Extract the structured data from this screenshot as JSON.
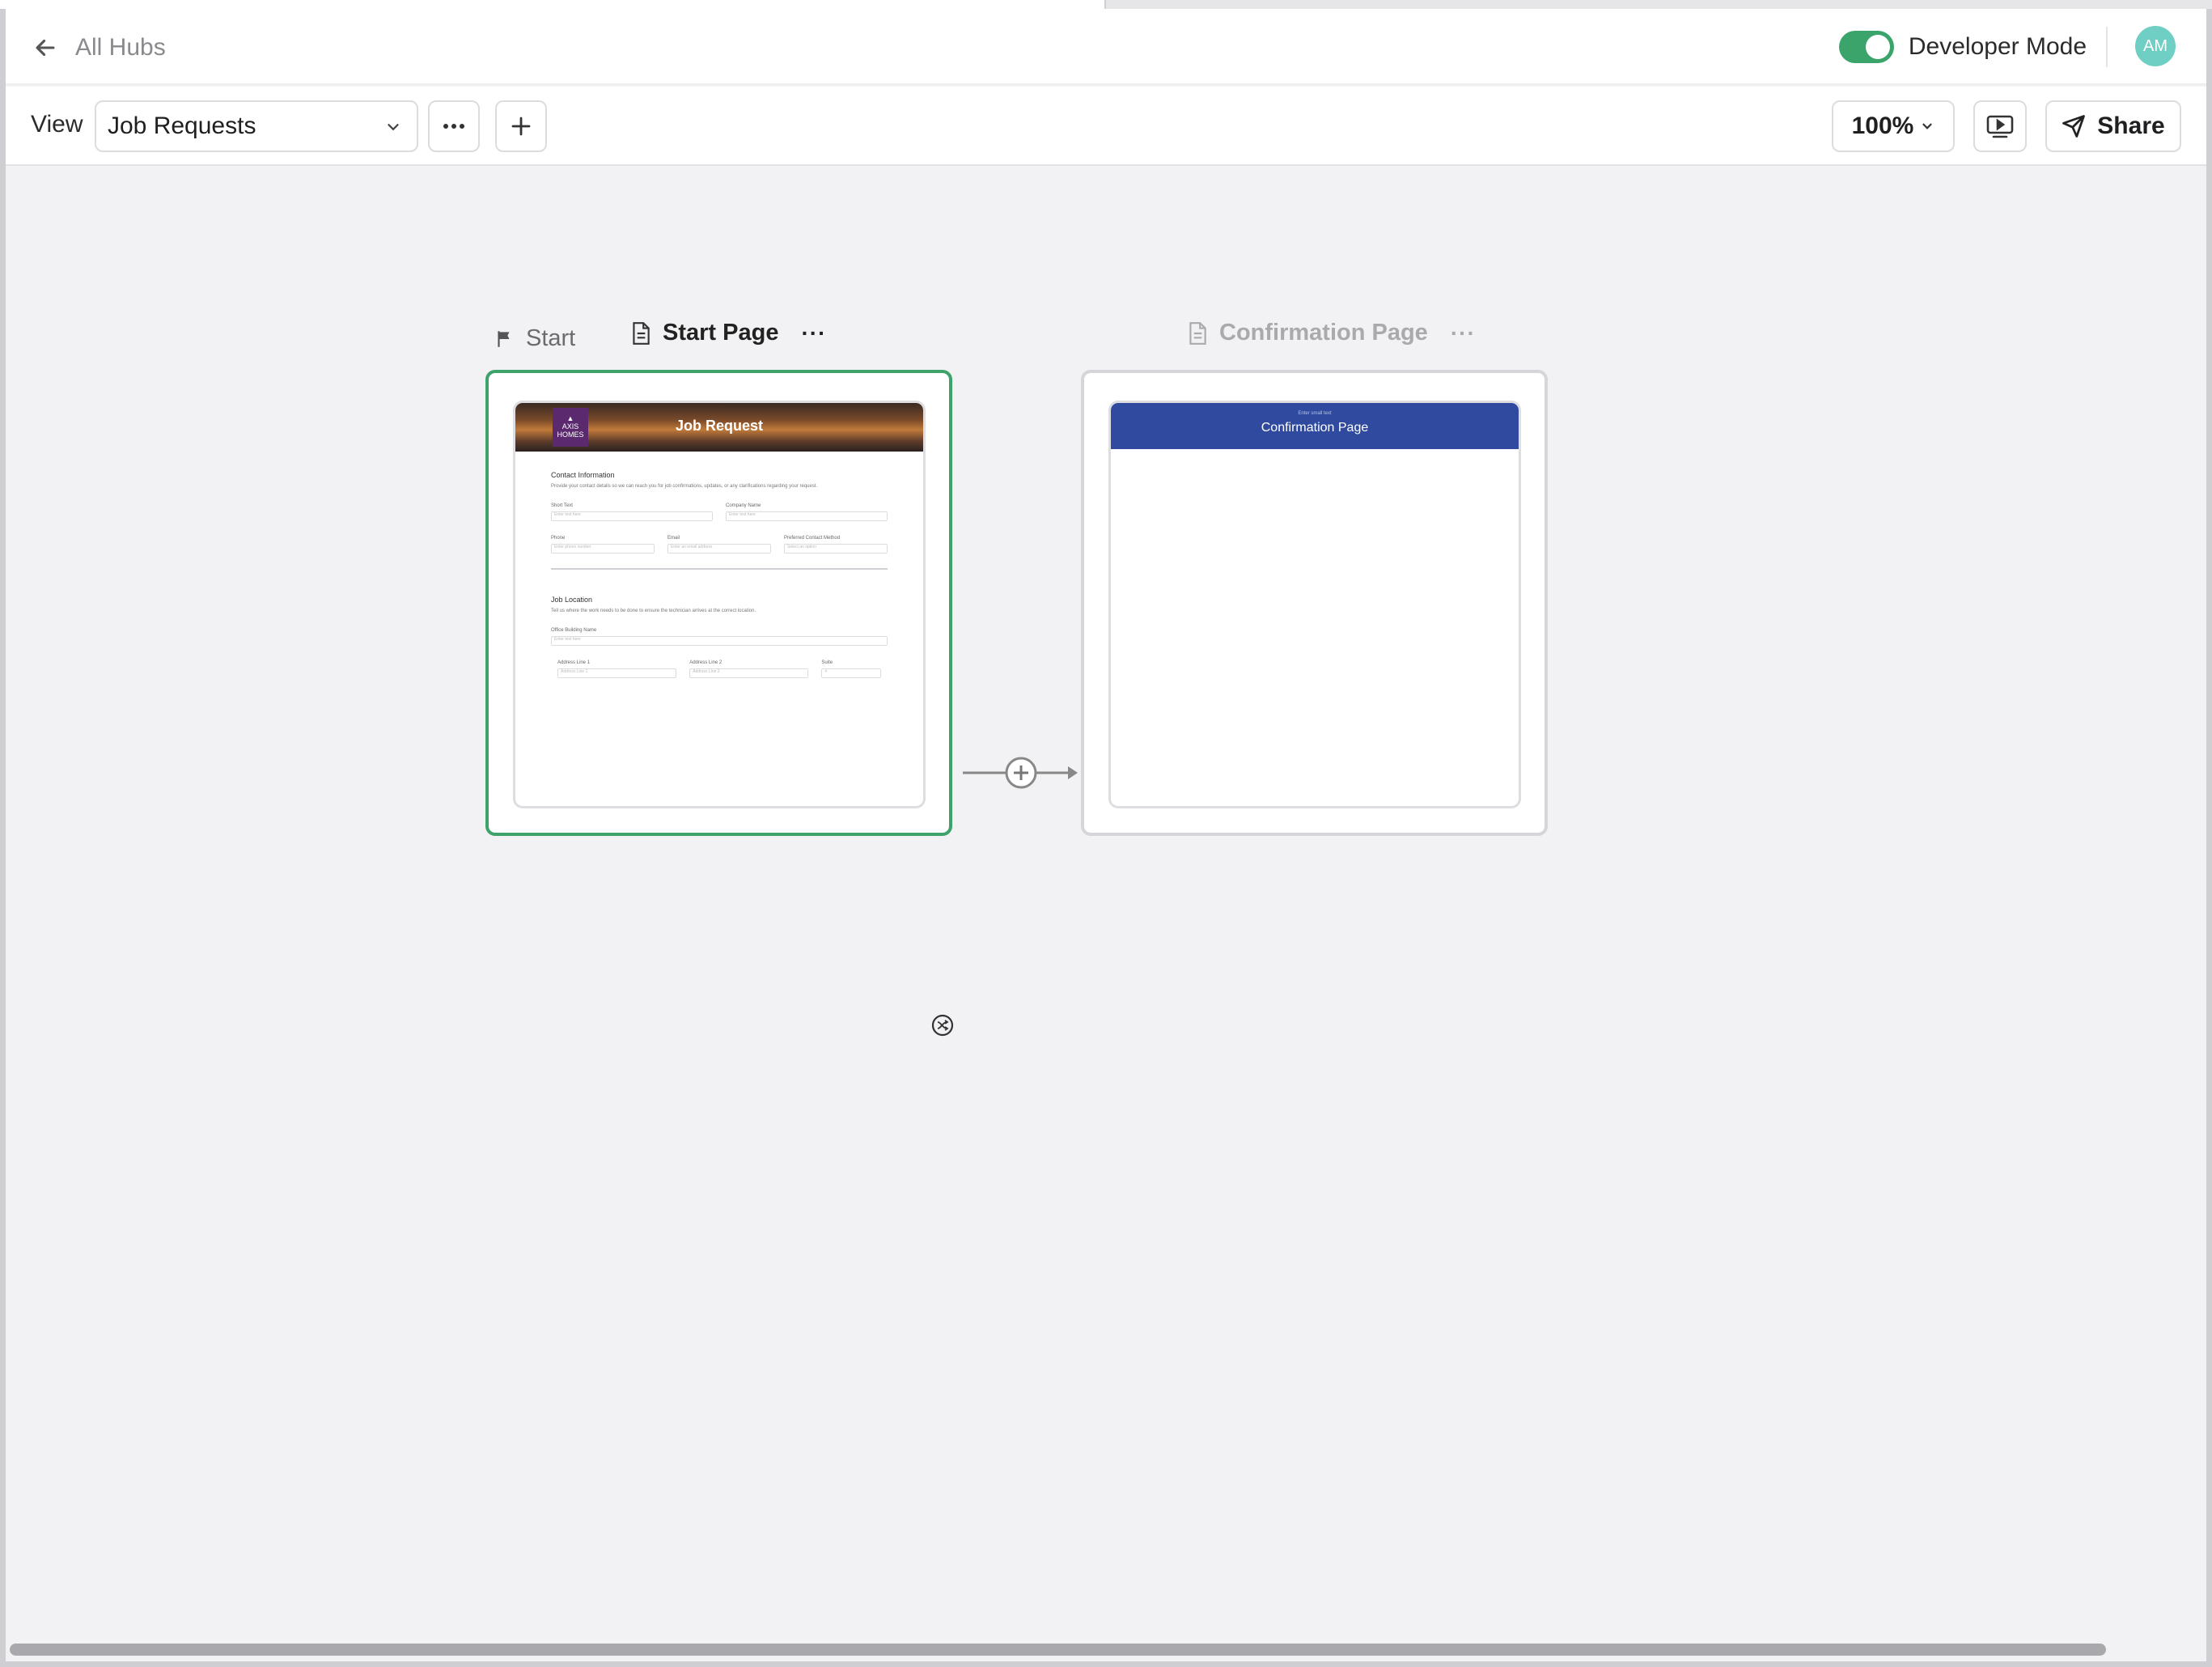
{
  "header": {
    "back_label": "All Hubs",
    "developer_mode_label": "Developer Mode",
    "developer_mode_on": true,
    "avatar_initials": "AM"
  },
  "toolbar": {
    "view_label": "View",
    "view_selected": "Job Requests",
    "more_icon": "ellipsis-icon",
    "add_icon": "plus-icon",
    "zoom_value": "100%",
    "present_icon": "present-icon",
    "share_label": "Share"
  },
  "canvas": {
    "start_label": "Start",
    "pages": [
      {
        "title": "Start Page",
        "preview_title": "Job Request",
        "logo_text": "AXIS HOMES",
        "sections": [
          {
            "heading": "Contact Information",
            "description": "Provide your contact details so we can reach you for job confirmations, updates, or any clarifications regarding your request.",
            "rows": [
              [
                {
                  "label": "Short Text",
                  "placeholder": "Enter text here"
                },
                {
                  "label": "Company Name",
                  "placeholder": "Enter text here"
                }
              ],
              [
                {
                  "label": "Phone",
                  "placeholder": "Enter phone number"
                },
                {
                  "label": "Email",
                  "placeholder": "Enter an email address"
                },
                {
                  "label": "Preferred Contact Method",
                  "placeholder": "Select an option"
                }
              ]
            ]
          },
          {
            "heading": "Job Location",
            "description": "Tell us where the work needs to be done to ensure the technician arrives at the correct location.",
            "rows": [
              [
                {
                  "label": "Office Building Name",
                  "placeholder": "Enter text here"
                }
              ],
              [
                {
                  "label": "Address Line 1",
                  "placeholder": "Address Line 1"
                },
                {
                  "label": "Address Line 2",
                  "placeholder": "Address Line 2"
                },
                {
                  "label": "Suite",
                  "placeholder": "#"
                }
              ]
            ]
          }
        ]
      },
      {
        "title": "Confirmation Page",
        "preview_small": "Enter small text",
        "preview_title": "Confirmation Page"
      }
    ]
  },
  "colors": {
    "accent_green": "#3ea36a",
    "banner_blue": "#2f4a9f",
    "avatar": "#6fcfc4"
  }
}
